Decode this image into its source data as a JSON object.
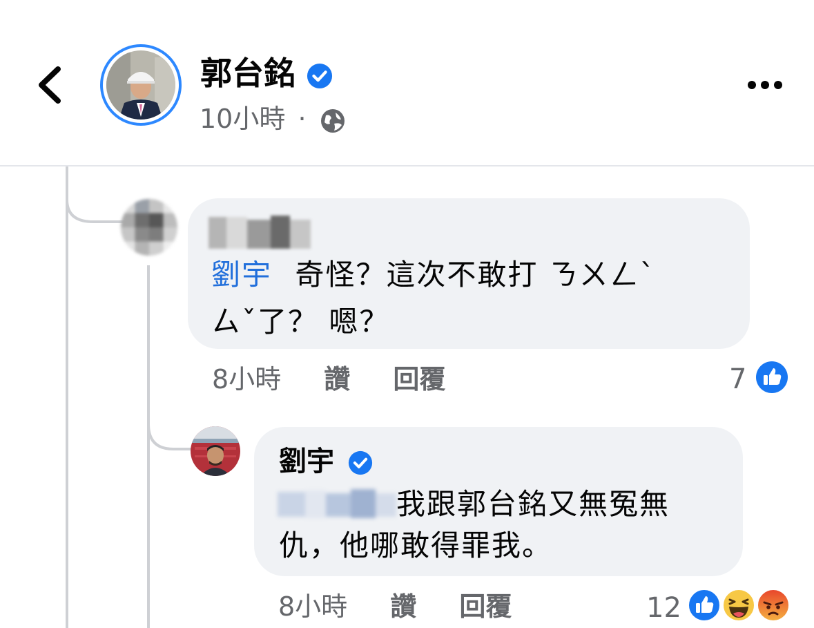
{
  "header": {
    "author_name": "郭台銘",
    "post_time": "10小時",
    "separator": "·",
    "icons": {
      "back": "chevron-left-icon",
      "verified": "verified-badge-icon",
      "privacy": "globe-icon",
      "more": "more-options-icon"
    }
  },
  "comments": [
    {
      "author_name_blurred": true,
      "mention": "劉宇",
      "text_line1": "奇怪？這次不敢打 ㄋㄨㄥˋ",
      "text_line2": "ㄙˇ了？ 嗯？",
      "time": "8小時",
      "like_label": "讚",
      "reply_label": "回覆",
      "reaction_count": "7",
      "reactions": [
        "like-icon"
      ]
    },
    {
      "author_name": "劉宇",
      "author_verified": true,
      "text_line1": "我跟郭台銘又無冤無",
      "text_line2": "仇，他哪敢得罪我。",
      "time": "8小時",
      "like_label": "讚",
      "reply_label": "回覆",
      "reaction_count": "12",
      "reactions": [
        "like-icon",
        "haha-icon",
        "angry-icon"
      ]
    }
  ],
  "colors": {
    "accent_blue": "#216fdb",
    "verified_blue": "#1877f2",
    "bubble_bg": "#f0f2f5",
    "secondary_text": "#65676b"
  }
}
